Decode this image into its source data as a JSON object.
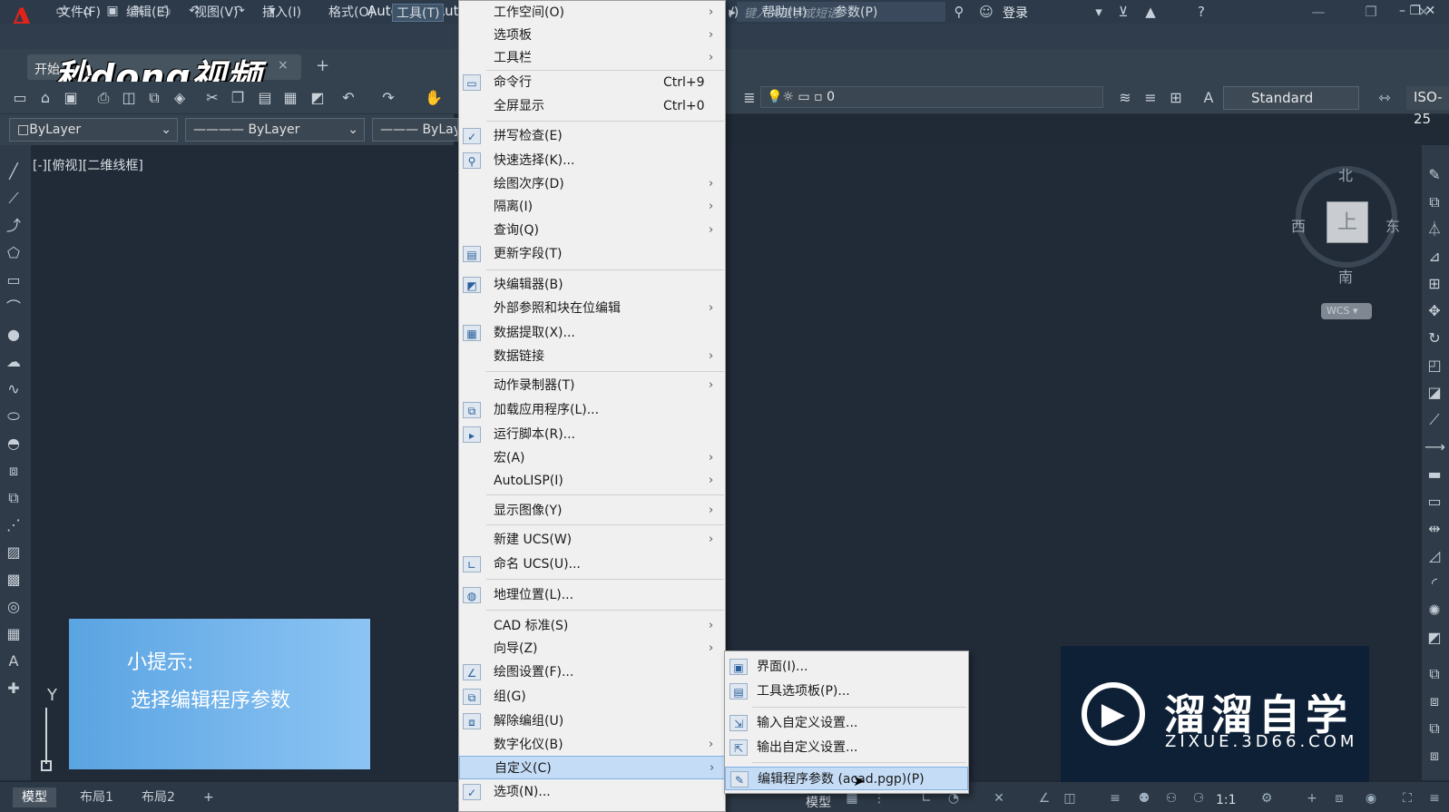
{
  "app": {
    "title": "Autodesk Aut",
    "logo_letter": "A",
    "search_placeholder": "键入关键字或短语",
    "login_label": "登录"
  },
  "menubar": {
    "items": [
      "文件(F)",
      "编辑(E)",
      "视图(V)",
      "插入(I)",
      "格式(O)",
      "工具(T)",
      "帮助(H)",
      "参数(P)"
    ],
    "partial_suffix": "/)"
  },
  "filetab": {
    "label": "开始",
    "close": "×",
    "new_tab": "+"
  },
  "watermark_text": "秒dong视频",
  "toolbar": {
    "layer_value": "0",
    "textstyle_value": "Standard",
    "dimstyle_value": "ISO-25"
  },
  "properties": {
    "color": "ByLayer",
    "linetype": "ByLayer",
    "lineweight": "ByLay"
  },
  "viewport": {
    "label": "[-][俯视][二维线框]",
    "viewcube": {
      "north": "北",
      "south": "南",
      "east": "东",
      "west": "西",
      "face": "上",
      "wcs": "WCS"
    },
    "ucs_y": "Y"
  },
  "tip": {
    "line1": "小提示:",
    "line2": "选择编辑程序参数"
  },
  "brand": {
    "name": "溜溜自学",
    "url": "ZIXUE.3D66.COM"
  },
  "statusbar": {
    "layout_tabs": [
      "模型",
      "布局1",
      "布局2"
    ],
    "add_layout": "+",
    "model_label": "模型",
    "scale": "1:1"
  },
  "tools_menu": {
    "items": [
      {
        "label": "工作空间(O)",
        "shortcut": "",
        "submenu": true,
        "icon": ""
      },
      {
        "label": "选项板",
        "shortcut": "",
        "submenu": true,
        "icon": ""
      },
      {
        "label": "工具栏",
        "shortcut": "",
        "submenu": true,
        "icon": ""
      },
      {
        "label": "命令行",
        "shortcut": "Ctrl+9",
        "submenu": false,
        "icon": "command-line-icon"
      },
      {
        "label": "全屏显示",
        "shortcut": "Ctrl+0",
        "submenu": false,
        "icon": ""
      },
      {
        "label": "拼写检查(E)",
        "shortcut": "",
        "submenu": false,
        "icon": "spell-check-icon"
      },
      {
        "label": "快速选择(K)...",
        "shortcut": "",
        "submenu": false,
        "icon": "quick-select-icon"
      },
      {
        "label": "绘图次序(D)",
        "shortcut": "",
        "submenu": true,
        "icon": ""
      },
      {
        "label": "隔离(I)",
        "shortcut": "",
        "submenu": true,
        "icon": ""
      },
      {
        "label": "查询(Q)",
        "shortcut": "",
        "submenu": true,
        "icon": ""
      },
      {
        "label": "更新字段(T)",
        "shortcut": "",
        "submenu": false,
        "icon": "update-field-icon"
      },
      {
        "label": "块编辑器(B)",
        "shortcut": "",
        "submenu": false,
        "icon": "block-editor-icon"
      },
      {
        "label": "外部参照和块在位编辑",
        "shortcut": "",
        "submenu": true,
        "icon": ""
      },
      {
        "label": "数据提取(X)...",
        "shortcut": "",
        "submenu": false,
        "icon": "data-extract-icon"
      },
      {
        "label": "数据链接",
        "shortcut": "",
        "submenu": true,
        "icon": ""
      },
      {
        "label": "动作录制器(T)",
        "shortcut": "",
        "submenu": true,
        "icon": ""
      },
      {
        "label": "加载应用程序(L)...",
        "shortcut": "",
        "submenu": false,
        "icon": "load-app-icon"
      },
      {
        "label": "运行脚本(R)...",
        "shortcut": "",
        "submenu": false,
        "icon": "run-script-icon"
      },
      {
        "label": "宏(A)",
        "shortcut": "",
        "submenu": true,
        "icon": ""
      },
      {
        "label": "AutoLISP(I)",
        "shortcut": "",
        "submenu": true,
        "icon": ""
      },
      {
        "label": "显示图像(Y)",
        "shortcut": "",
        "submenu": true,
        "icon": ""
      },
      {
        "label": "新建 UCS(W)",
        "shortcut": "",
        "submenu": true,
        "icon": ""
      },
      {
        "label": "命名 UCS(U)...",
        "shortcut": "",
        "submenu": false,
        "icon": "named-ucs-icon"
      },
      {
        "label": "地理位置(L)...",
        "shortcut": "",
        "submenu": false,
        "icon": "geolocation-icon"
      },
      {
        "label": "CAD 标准(S)",
        "shortcut": "",
        "submenu": true,
        "icon": ""
      },
      {
        "label": "向导(Z)",
        "shortcut": "",
        "submenu": true,
        "icon": ""
      },
      {
        "label": "绘图设置(F)...",
        "shortcut": "",
        "submenu": false,
        "icon": "drafting-settings-icon"
      },
      {
        "label": "组(G)",
        "shortcut": "",
        "submenu": false,
        "icon": "group-icon"
      },
      {
        "label": "解除编组(U)",
        "shortcut": "",
        "submenu": false,
        "icon": "ungroup-icon"
      },
      {
        "label": "数字化仪(B)",
        "shortcut": "",
        "submenu": true,
        "icon": ""
      },
      {
        "label": "自定义(C)",
        "shortcut": "",
        "submenu": true,
        "icon": ""
      },
      {
        "label": "选项(N)...",
        "shortcut": "",
        "submenu": false,
        "icon": "options-icon"
      }
    ]
  },
  "customize_submenu": {
    "items": [
      {
        "label": "界面(I)...",
        "icon": "interface-icon"
      },
      {
        "label": "工具选项板(P)...",
        "icon": "tool-palettes-icon"
      },
      {
        "label": "输入自定义设置...",
        "icon": "import-customization-icon"
      },
      {
        "label": "输出自定义设置...",
        "icon": "export-customization-icon"
      },
      {
        "label": "编辑程序参数 (acad.pgp)(P)",
        "icon": "edit-pgp-icon"
      }
    ]
  }
}
